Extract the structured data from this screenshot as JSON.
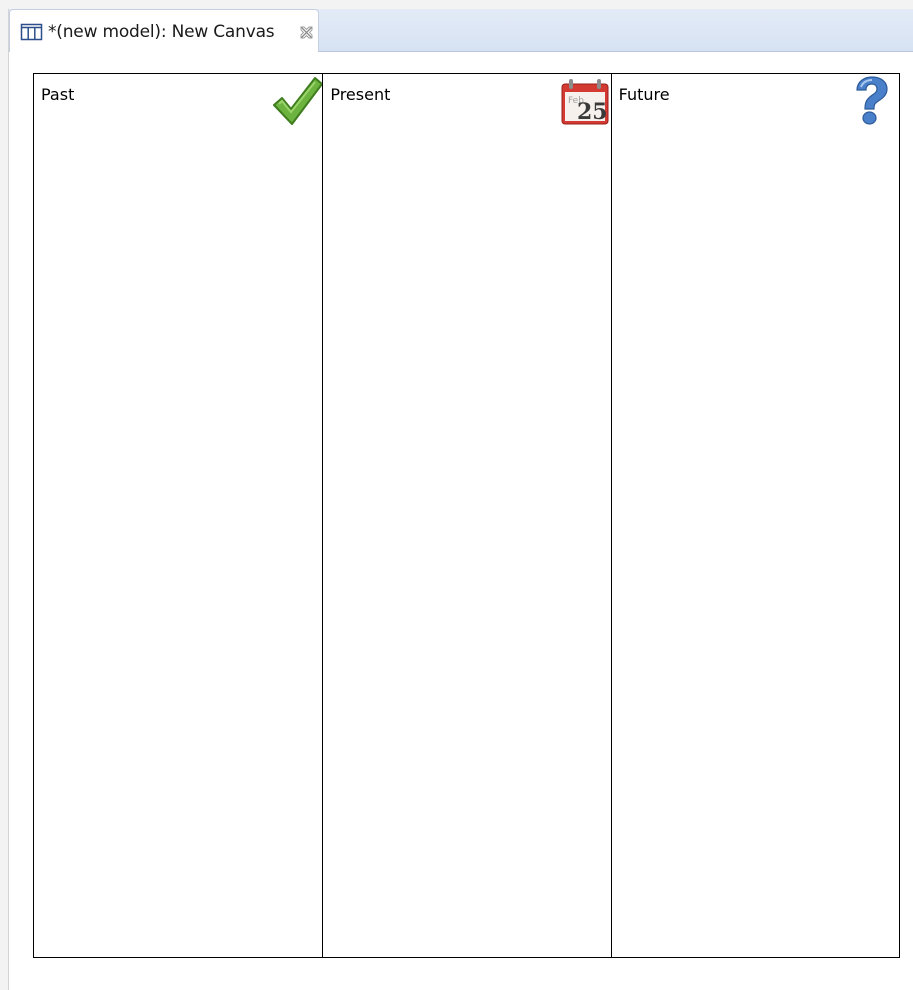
{
  "editor": {
    "tab": {
      "title": "*(new model): New Canvas",
      "icon": "canvas-grid-icon",
      "close_icon": "close-icon"
    }
  },
  "canvas": {
    "lanes": [
      {
        "label": "Past",
        "icon": "checkmark-icon",
        "icon_color": "#5aa833"
      },
      {
        "label": "Present",
        "icon": "calendar-icon",
        "icon_color": "#d23a32",
        "icon_month": "Feb",
        "icon_day": "25"
      },
      {
        "label": "Future",
        "icon": "question-mark-icon",
        "icon_color": "#3c73c0"
      }
    ]
  },
  "colors": {
    "tab_strip": "#d6e2f3",
    "lane_border": "#000000"
  }
}
